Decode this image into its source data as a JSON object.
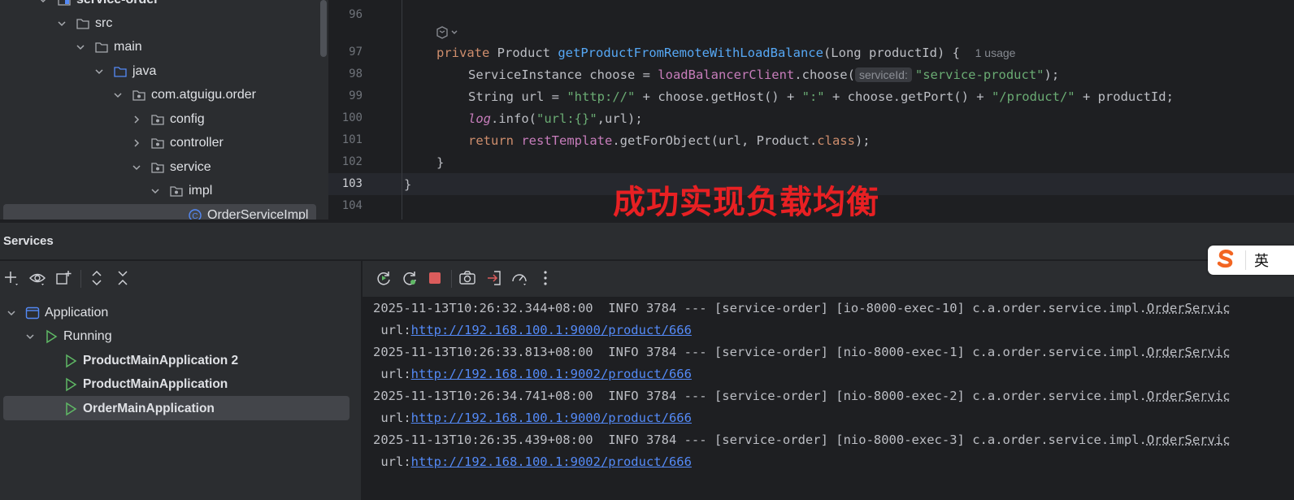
{
  "project_tree": {
    "items": [
      {
        "label": "service-order",
        "depth": 2,
        "icon": "module-folder-icon",
        "expanded": true
      },
      {
        "label": "src",
        "depth": 3,
        "icon": "folder-icon",
        "expanded": true
      },
      {
        "label": "main",
        "depth": 4,
        "icon": "folder-icon",
        "expanded": true
      },
      {
        "label": "java",
        "depth": 5,
        "icon": "source-folder-icon",
        "expanded": true
      },
      {
        "label": "com.atguigu.order",
        "depth": 6,
        "icon": "package-icon",
        "expanded": true
      },
      {
        "label": "config",
        "depth": 7,
        "icon": "package-icon",
        "expanded": false
      },
      {
        "label": "controller",
        "depth": 7,
        "icon": "package-icon",
        "expanded": false
      },
      {
        "label": "service",
        "depth": 7,
        "icon": "package-icon",
        "expanded": true
      },
      {
        "label": "impl",
        "depth": 8,
        "icon": "package-icon",
        "expanded": true
      },
      {
        "label": "OrderServiceImpl",
        "depth": 9,
        "icon": "class-icon",
        "expanded": null
      }
    ]
  },
  "editor": {
    "line_numbers": [
      "96",
      "97",
      "98",
      "99",
      "100",
      "101",
      "102",
      "103",
      "104"
    ],
    "current_line": "103",
    "usage_hint": "1 usage",
    "param_hint": "serviceId:",
    "code": {
      "l97": {
        "kw": "private",
        "type": "Product",
        "method": "getProductFromRemoteWithLoadBalance",
        "params": "(Long productId) {"
      },
      "l98": {
        "a": "ServiceInstance choose = ",
        "field": "loadBalancerClient",
        "b": ".choose(",
        "str": "\"service-product\"",
        "c": ");"
      },
      "l99": {
        "a": "String url = ",
        "s1": "\"http://\"",
        "b": " + choose.getHost() + ",
        "s2": "\":\"",
        "c": " + choose.getPort() + ",
        "s3": "\"/product/\"",
        "d": " + productId;"
      },
      "l100": {
        "field": "log",
        "a": ".info(",
        "str": "\"url:{}\"",
        "b": ",url);"
      },
      "l101": {
        "kw": "return",
        "field": "restTemplate",
        "a": ".getForObject(url, Product.",
        "kw2": "class",
        "b": ");"
      },
      "l102": "}",
      "l103": "}"
    },
    "banner": "成功实现负载均衡"
  },
  "services": {
    "title": "Services",
    "tree": [
      {
        "label": "Application",
        "icon": "application-icon"
      },
      {
        "label": "Running",
        "icon": "run-icon"
      },
      {
        "label": "ProductMainApplication 2",
        "icon": "run-icon"
      },
      {
        "label": "ProductMainApplication",
        "icon": "run-icon"
      },
      {
        "label": "OrderMainApplication",
        "icon": "run-icon"
      }
    ],
    "selected": "OrderMainApplication"
  },
  "console": {
    "lines": [
      {
        "head": "2025-11-13T10:26:32.344+08:00  INFO 3784 --- [service-order] [io-8000-exec-10] c.a.order.service.impl.",
        "cls": "OrderServic",
        "url_prefix": " url:",
        "url": "http://192.168.100.1:9000/product/666"
      },
      {
        "head": "2025-11-13T10:26:33.813+08:00  INFO 3784 --- [service-order] [nio-8000-exec-1] c.a.order.service.impl.",
        "cls": "OrderServic",
        "url_prefix": " url:",
        "url": "http://192.168.100.1:9002/product/666"
      },
      {
        "head": "2025-11-13T10:26:34.741+08:00  INFO 3784 --- [service-order] [nio-8000-exec-2] c.a.order.service.impl.",
        "cls": "OrderServic",
        "url_prefix": " url:",
        "url": "http://192.168.100.1:9000/product/666"
      },
      {
        "head": "2025-11-13T10:26:35.439+08:00  INFO 3784 --- [service-order] [nio-8000-exec-3] c.a.order.service.impl.",
        "cls": "OrderServic",
        "url_prefix": " url:",
        "url": "http://192.168.100.1:9002/product/666"
      }
    ]
  },
  "ime": {
    "label": "英",
    "logo": "sogou-s-logo-icon"
  },
  "colors": {
    "banner": "#e82023",
    "link": "#548af7",
    "keyword": "#cf8e6d",
    "string": "#6aab73",
    "method": "#56a8f5",
    "field": "#c77dbb",
    "run_green": "#5fb865",
    "stop_red": "#db5c5c"
  }
}
